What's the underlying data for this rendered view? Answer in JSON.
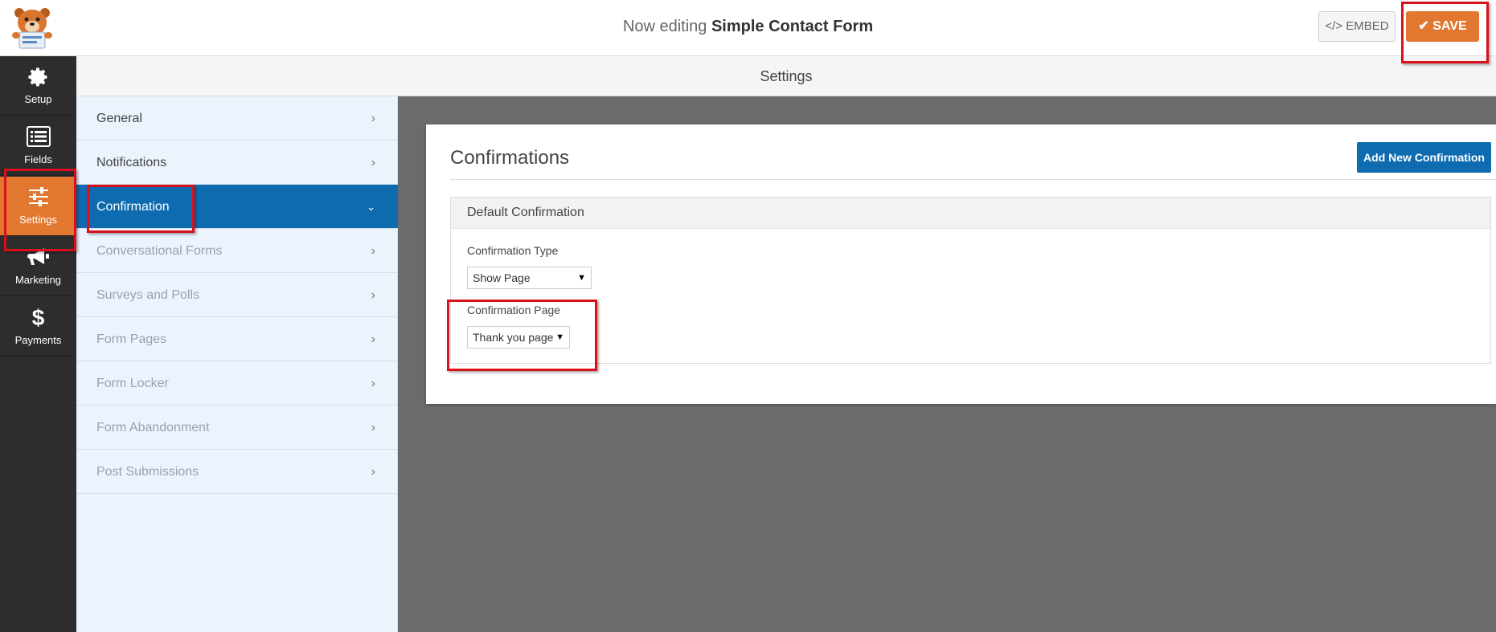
{
  "header": {
    "title_prefix": "Now editing",
    "form_name": "Simple Contact Form",
    "embed_label": "</> EMBED",
    "save_label": "SAVE"
  },
  "rail": {
    "items": [
      {
        "label": "Setup",
        "icon": "gear-icon"
      },
      {
        "label": "Fields",
        "icon": "list-icon"
      },
      {
        "label": "Settings",
        "icon": "sliders-icon",
        "active": true
      },
      {
        "label": "Marketing",
        "icon": "megaphone-icon"
      },
      {
        "label": "Payments",
        "icon": "dollar-icon"
      }
    ]
  },
  "settings_header": "Settings",
  "sidebar": {
    "items": [
      {
        "label": "General"
      },
      {
        "label": "Notifications"
      },
      {
        "label": "Confirmation",
        "active": true
      },
      {
        "label": "Conversational Forms"
      },
      {
        "label": "Surveys and Polls"
      },
      {
        "label": "Form Pages"
      },
      {
        "label": "Form Locker"
      },
      {
        "label": "Form Abandonment"
      },
      {
        "label": "Post Submissions"
      }
    ]
  },
  "panel": {
    "title": "Confirmations",
    "add_button": "Add New Confirmation",
    "block_title": "Default Confirmation",
    "type_label": "Confirmation Type",
    "type_value": "Show Page",
    "page_label": "Confirmation Page",
    "page_value": "Thank you page"
  },
  "colors": {
    "accent_orange": "#e27730",
    "accent_blue": "#0e6bb0",
    "highlight_red": "#d9101b",
    "rail_bg": "#2d2d2d",
    "sidebar_bg": "#ebf3fc"
  }
}
